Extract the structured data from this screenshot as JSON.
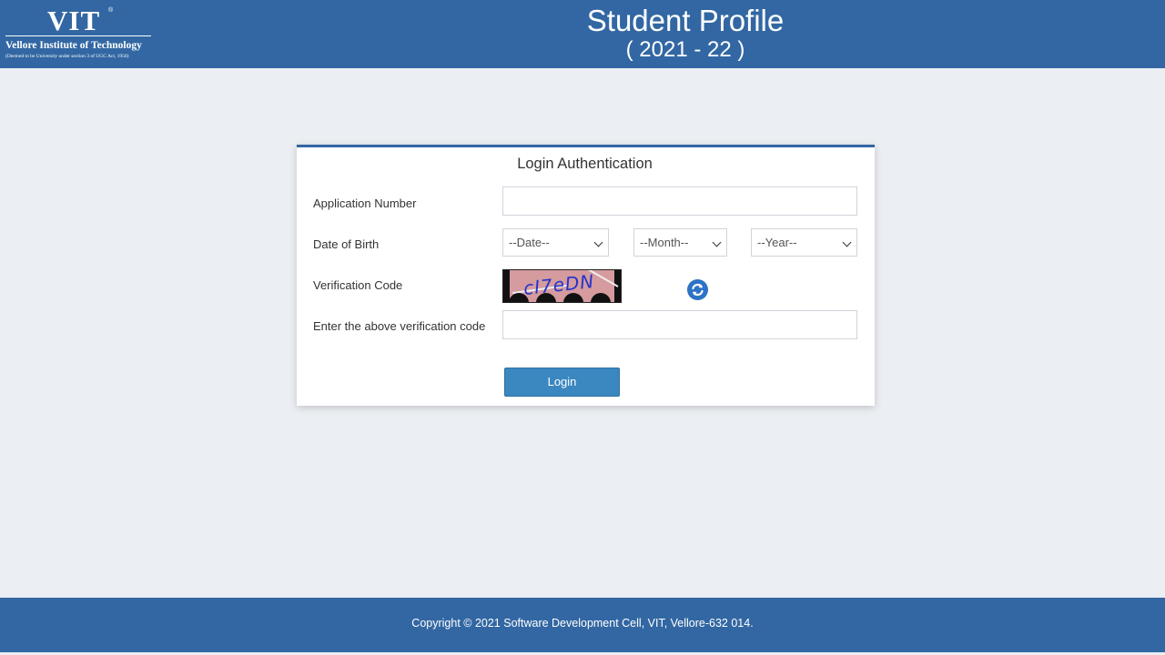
{
  "header": {
    "logo": {
      "main": "VIT",
      "reg": "®",
      "name": "Vellore Institute of Technology",
      "sub": "(Deemed to be University under section 3 of UGC Act, 1956)"
    },
    "title": "Student Profile",
    "year": "( 2021 - 22 )"
  },
  "form": {
    "title": "Login Authentication",
    "application_number": {
      "label": "Application Number",
      "value": "",
      "placeholder": ""
    },
    "dob": {
      "label": "Date of Birth",
      "date": "--Date--",
      "month": "--Month--",
      "year": "--Year--"
    },
    "verification": {
      "label": "Verification Code",
      "captcha_text": "cI7eDN",
      "refresh_icon": "refresh-icon"
    },
    "verification_input": {
      "label": "Enter the above verification code",
      "value": "",
      "placeholder": ""
    },
    "login_label": "Login"
  },
  "footer": {
    "copyright": "Copyright © 2021 Software Development Cell, VIT, Vellore-632 014."
  },
  "colors": {
    "brand": "#3267a3",
    "button": "#3b87c0",
    "background": "#ebeef2"
  }
}
